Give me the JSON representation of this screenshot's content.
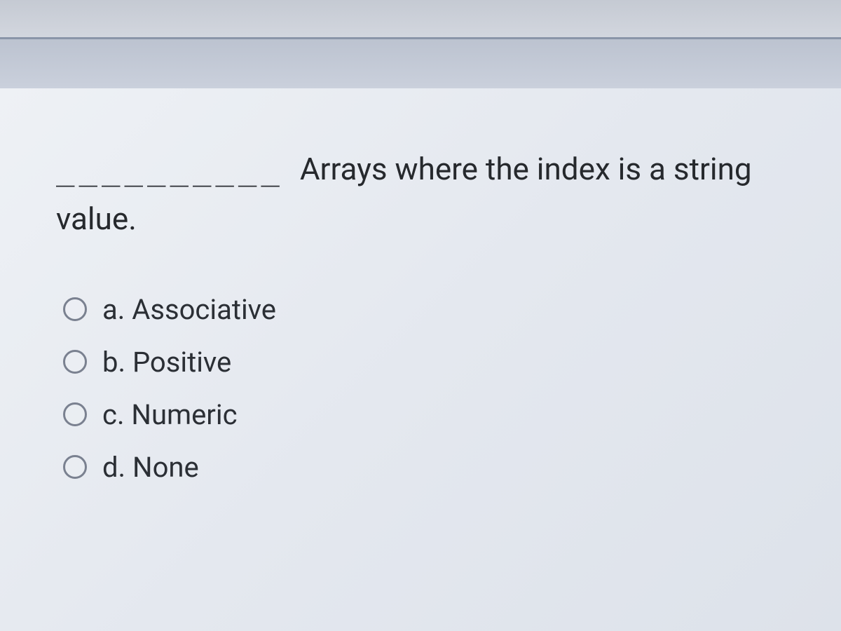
{
  "question": {
    "blank": "__________",
    "text_after_blank": "Arrays where the index is a string value."
  },
  "options": [
    {
      "letter": "a.",
      "text": "Associative"
    },
    {
      "letter": "b.",
      "text": "Positive"
    },
    {
      "letter": "c.",
      "text": "Numeric"
    },
    {
      "letter": "d.",
      "text": "None"
    }
  ]
}
